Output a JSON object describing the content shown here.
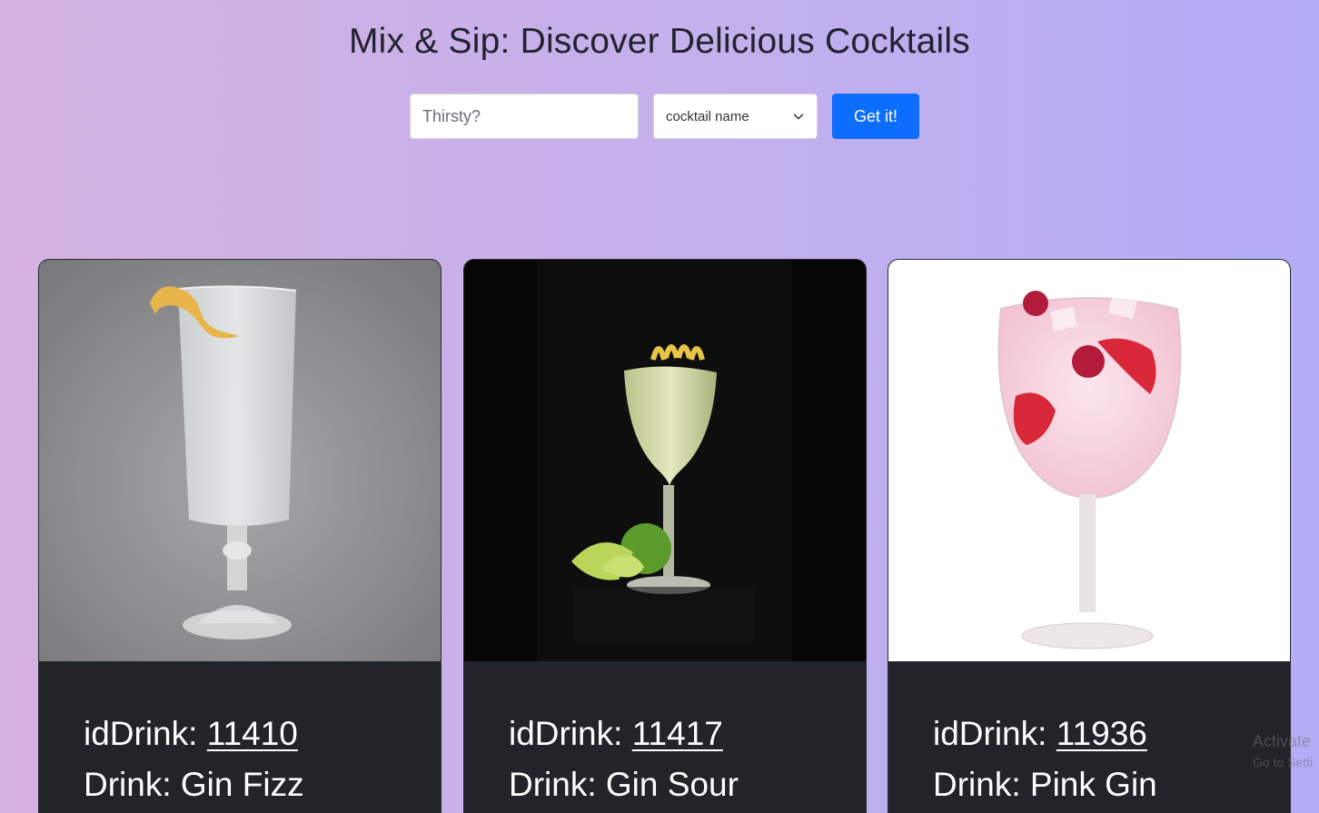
{
  "header": {
    "title": "Mix & Sip: Discover Delicious Cocktails"
  },
  "search": {
    "placeholder": "Thirsty?",
    "value": "",
    "select_value": "cocktail name",
    "button_label": "Get it!"
  },
  "colors": {
    "button_bg": "#0d6efd",
    "card_body_bg": "#212529"
  },
  "cards": [
    {
      "id_label": "idDrink",
      "id_value": "11410",
      "drink_label": "Drink",
      "drink_value": "Gin Fizz"
    },
    {
      "id_label": "idDrink",
      "id_value": "11417",
      "drink_label": "Drink",
      "drink_value": "Gin Sour"
    },
    {
      "id_label": "idDrink",
      "id_value": "11936",
      "drink_label": "Drink",
      "drink_value": "Pink Gin"
    }
  ],
  "watermark": {
    "line1": "Activate",
    "line2": "Go to Setti"
  }
}
